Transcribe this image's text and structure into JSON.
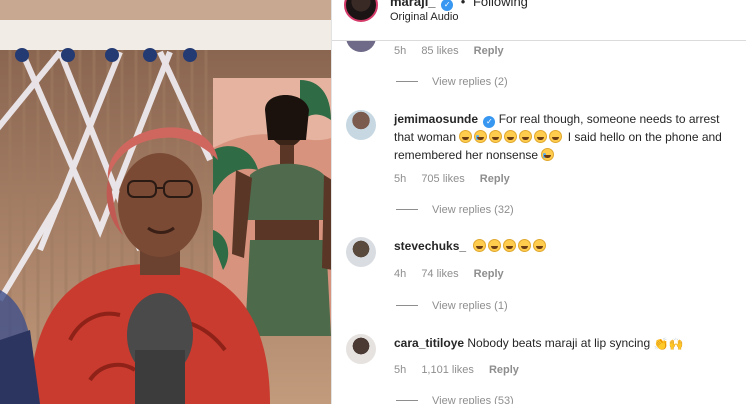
{
  "post": {
    "username": "maraji_",
    "status": "Following",
    "audio": "Original Audio"
  },
  "top_partial": {
    "time": "5h",
    "likes": "85 likes",
    "reply": "Reply",
    "view_replies": "View replies (2)"
  },
  "comments": [
    {
      "username": "jemimaosunde",
      "verified": true,
      "text_a": "For real though, someone needs to arrest that woman",
      "text_b": "I said hello on the phone and remembered her nonsense",
      "emojis_a": [
        "grin-icon",
        "cry-icon",
        "grin-icon",
        "grin-icon",
        "grin-icon",
        "grin-icon",
        "grin-icon"
      ],
      "time": "5h",
      "likes": "705 likes",
      "reply": "Reply",
      "view_replies": "View replies (32)"
    },
    {
      "username": "stevechuks_",
      "verified": false,
      "text": "",
      "time": "4h",
      "likes": "74 likes",
      "reply": "Reply",
      "view_replies": "View replies (1)"
    },
    {
      "username": "cara_titiloye",
      "verified": false,
      "text": "Nobody beats maraji at lip syncing",
      "time": "5h",
      "likes": "1,101 likes",
      "reply": "Reply",
      "view_replies": "View replies (53)"
    }
  ],
  "colors": {
    "accent": "#3897f0",
    "muted": "#8e8e8e",
    "text": "#262626"
  }
}
